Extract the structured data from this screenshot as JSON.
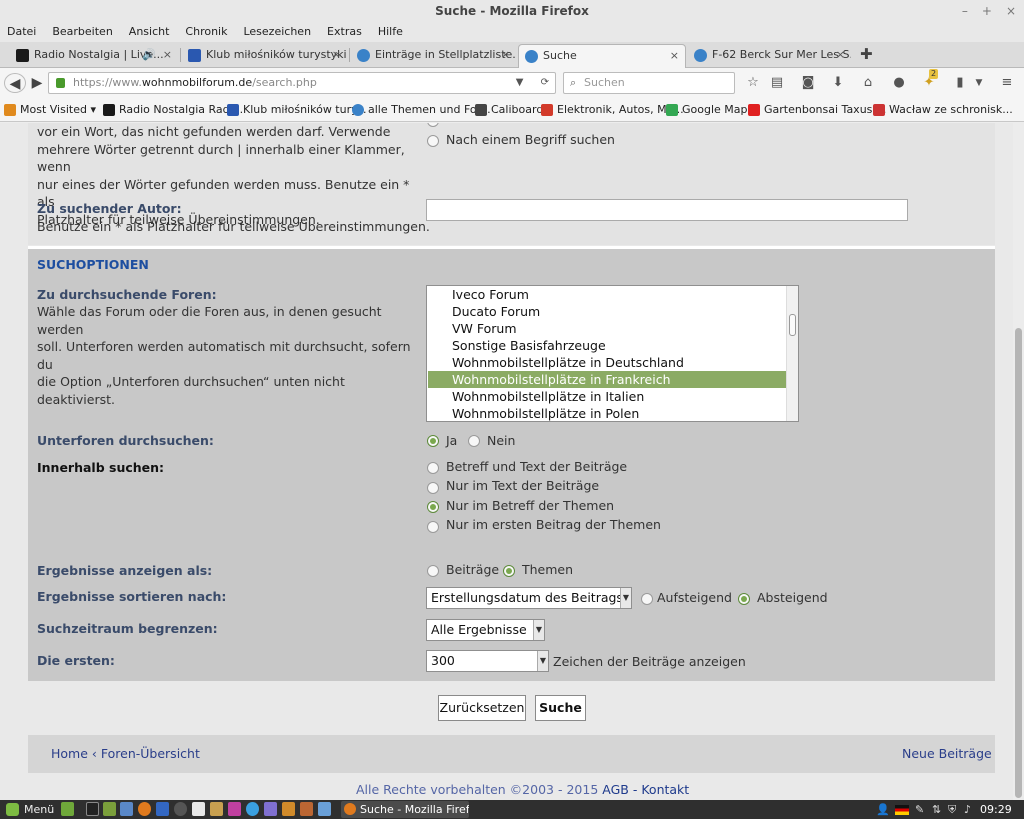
{
  "window": {
    "title": "Suche - Mozilla Firefox"
  },
  "menu": [
    "Datei",
    "Bearbeiten",
    "Ansicht",
    "Chronik",
    "Lesezeichen",
    "Extras",
    "Hilfe"
  ],
  "tabs": [
    {
      "label": "Radio Nostalgia | Live...",
      "color": "#1a1a1a"
    },
    {
      "label": "Klub miłośników turystyki ...",
      "color": "#2a58b0"
    },
    {
      "label": "Einträge in Stellplatzliste...",
      "color": "#3a82c8"
    },
    {
      "label": "Suche",
      "color": "#3a82c8"
    },
    {
      "label": "F-62 Berck Sur Mer Les S...",
      "color": "#3a82c8"
    }
  ],
  "nav": {
    "url_prefix": "https://www.",
    "url_host": "wohnmobilforum.de",
    "url_path": "/search.php",
    "search_placeholder": "Suchen",
    "badge": "2"
  },
  "bookmarks": [
    {
      "label": "Most Visited ▾",
      "color": "#e08a1e"
    },
    {
      "label": "Radio Nostalgia Radi...",
      "color": "#1a1a1a"
    },
    {
      "label": "Klub miłośników tury...",
      "color": "#2a58b0"
    },
    {
      "label": "alle Themen und For...",
      "color": "#3a82c8"
    },
    {
      "label": "Caliboard",
      "color": "#444444"
    },
    {
      "label": "Elektronik, Autos, Mo...",
      "color": "#d23a2a"
    },
    {
      "label": "Google Maps",
      "color": "#34a853"
    },
    {
      "label": "Gartenbonsai Taxus ...",
      "color": "#e02020"
    },
    {
      "label": "Wacław ze schronisk...",
      "color": "#cc3333"
    }
  ],
  "form": {
    "top_help_lines": [
      "vor ein Wort, das nicht gefunden werden darf. Verwende",
      "mehrere Wörter getrennt durch | innerhalb einer Klammer, wenn",
      "nur eines der Wörter gefunden werden muss. Benutze ein * als",
      "Platzhalter für teilweise Übereinstimmungen."
    ],
    "search_term_option": "Nach einem Begriff suchen",
    "author_label": "Zu suchender Autor:",
    "author_help": "Benutze ein * als Platzhalter für teilweise Übereinstimmungen.",
    "author_value": "",
    "options_heading": "SUCHOPTIONEN",
    "forums_label": "Zu durchsuchende Foren:",
    "forums_help": [
      "Wähle das Forum oder die Foren aus, in denen gesucht werden",
      "soll. Unterforen werden automatisch mit durchsucht, sofern du",
      "die Option „Unterforen durchsuchen“ unten nicht deaktivierst."
    ],
    "forums": [
      "Iveco Forum",
      "Ducato Forum",
      "VW Forum",
      "Sonstige Basisfahrzeuge",
      "Wohnmobilstellplätze in Deutschland",
      "Wohnmobilstellplätze in Frankreich",
      "Wohnmobilstellplätze in Italien",
      "Wohnmobilstellplätze in Polen"
    ],
    "forums_selected": "Wohnmobilstellplätze in Frankreich",
    "subforums_label": "Unterforen durchsuchen:",
    "subforums_yes": "Ja",
    "subforums_no": "Nein",
    "within_label": "Innerhalb suchen:",
    "within_options": [
      "Betreff und Text der Beiträge",
      "Nur im Text der Beiträge",
      "Nur im Betreff der Themen",
      "Nur im ersten Beitrag der Themen"
    ],
    "within_selected": "Nur im Betreff der Themen",
    "display_label": "Ergebnisse anzeigen als:",
    "display_posts": "Beiträge",
    "display_topics": "Themen",
    "sort_label": "Ergebnisse sortieren nach:",
    "sort_value": "Erstellungsdatum des Beitrags",
    "sort_asc": "Aufsteigend",
    "sort_desc": "Absteigend",
    "timeframe_label": "Suchzeitraum begrenzen:",
    "timeframe_value": "Alle Ergebnisse",
    "first_label": "Die ersten:",
    "first_value": "300",
    "first_suffix": "Zeichen der Beiträge anzeigen",
    "reset_label": "Zurücksetzen",
    "submit_label": "Suche"
  },
  "footer": {
    "home": "Home",
    "separator": "‹",
    "forum_overview": "Foren-Übersicht",
    "new_posts": "Neue Beiträge",
    "copyright": "Alle Rechte vorbehalten ©2003 - 2015",
    "agb": "AGB",
    "dash": "-",
    "kontakt": "Kontakt"
  },
  "taskbar": {
    "menu_label": "Menü",
    "window_label": "Suche - Mozilla Firefox",
    "clock": "09:29"
  },
  "colors": {
    "selected_option": "#8bab64",
    "options_panel": "#c8c8c8",
    "label_blue": "#3a4b6a",
    "heading_blue": "#1d4ea0",
    "link_blue": "#2a3e8a"
  }
}
